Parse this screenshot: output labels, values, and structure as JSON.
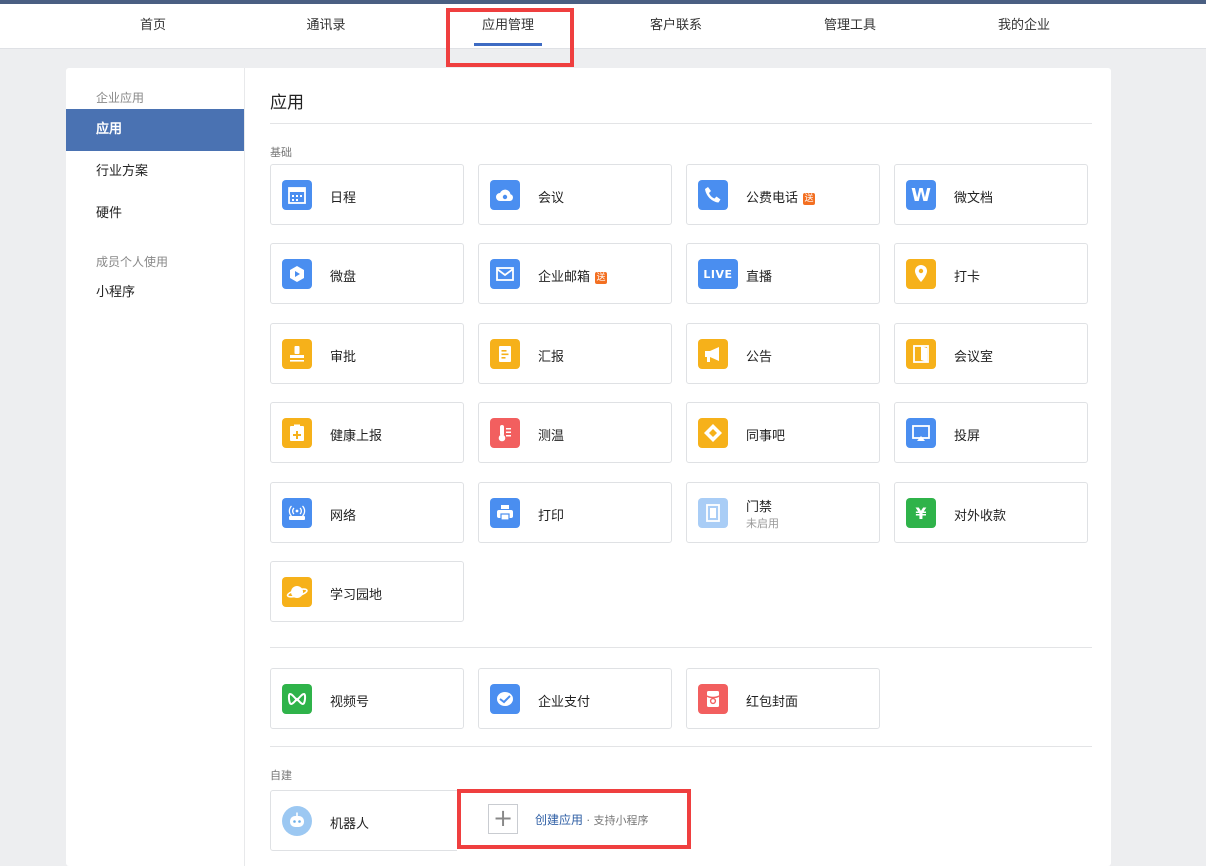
{
  "nav": {
    "items": [
      {
        "label": "首页"
      },
      {
        "label": "通讯录"
      },
      {
        "label": "应用管理"
      },
      {
        "label": "客户联系"
      },
      {
        "label": "管理工具"
      },
      {
        "label": "我的企业"
      }
    ],
    "active": "应用管理"
  },
  "sidebar": {
    "section1": "企业应用",
    "items1": [
      {
        "label": "应用"
      },
      {
        "label": "行业方案"
      },
      {
        "label": "硬件"
      }
    ],
    "section2": "成员个人使用",
    "items2": [
      {
        "label": "小程序"
      }
    ]
  },
  "content": {
    "title": "应用",
    "basic_label": "基础",
    "basic_apps": [
      {
        "name": "日程",
        "icon": "calendar-icon"
      },
      {
        "name": "会议",
        "icon": "cloud-meeting-icon"
      },
      {
        "name": "公费电话",
        "icon": "phone-icon",
        "badge": "送"
      },
      {
        "name": "微文档",
        "icon": "word-doc-icon",
        "glyph": "W"
      },
      {
        "name": "微盘",
        "icon": "drive-icon"
      },
      {
        "name": "企业邮箱",
        "icon": "mail-icon",
        "badge": "送"
      },
      {
        "name": "直播",
        "icon": "live-icon",
        "glyph": "LIVE"
      },
      {
        "name": "打卡",
        "icon": "location-pin-icon"
      },
      {
        "name": "审批",
        "icon": "stamp-icon"
      },
      {
        "name": "汇报",
        "icon": "report-icon"
      },
      {
        "name": "公告",
        "icon": "megaphone-icon"
      },
      {
        "name": "会议室",
        "icon": "door-icon"
      },
      {
        "name": "健康上报",
        "icon": "health-report-icon"
      },
      {
        "name": "测温",
        "icon": "thermometer-icon"
      },
      {
        "name": "同事吧",
        "icon": "community-icon"
      },
      {
        "name": "投屏",
        "icon": "screencast-icon"
      },
      {
        "name": "网络",
        "icon": "router-icon"
      },
      {
        "name": "打印",
        "icon": "printer-icon"
      },
      {
        "name": "门禁",
        "icon": "access-door-icon",
        "sub": "未启用"
      },
      {
        "name": "对外收款",
        "icon": "yuan-shield-icon",
        "glyph": "¥"
      },
      {
        "name": "学习园地",
        "icon": "planet-icon"
      }
    ],
    "extra_apps": [
      {
        "name": "视频号",
        "icon": "channels-icon"
      },
      {
        "name": "企业支付",
        "icon": "pay-icon"
      },
      {
        "name": "红包封面",
        "icon": "red-packet-icon"
      }
    ],
    "custom_label": "自建",
    "custom_apps": [
      {
        "name": "机器人",
        "icon": "robot-icon"
      }
    ],
    "create": {
      "label": "创建应用",
      "sep": " · ",
      "sub": "支持小程序"
    }
  },
  "colors": {
    "accent": "#4a72b2",
    "highlight": "#ef3f3f",
    "link": "#2f5fa5"
  }
}
